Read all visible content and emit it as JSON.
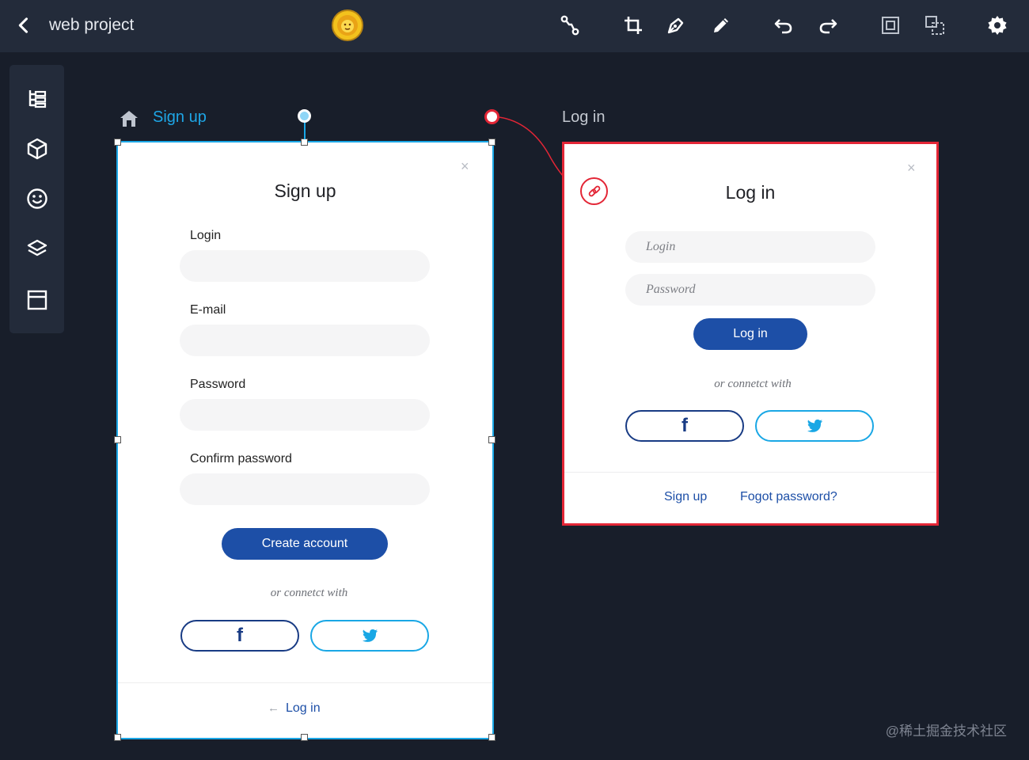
{
  "app": {
    "project_title": "web project",
    "watermark": "@稀土掘金技术社区"
  },
  "toolbar": {
    "back_icon": "chevron-left-icon",
    "tools": [
      "connect-icon",
      "crop-icon",
      "pen-icon",
      "pencil-icon",
      "undo-icon",
      "redo-icon",
      "frame-icon",
      "group-icon",
      "settings-icon"
    ]
  },
  "sidebar": {
    "items": [
      "layers-tree-icon",
      "cube-icon",
      "smiley-icon",
      "stack-icon",
      "panel-icon"
    ]
  },
  "colors": {
    "selection": "#1aa7e6",
    "link_accent": "#e32636",
    "primary": "#1d4fa7",
    "facebook": "#183b84",
    "twitter": "#19a7e5"
  },
  "signup_frame": {
    "label": "Sign up",
    "title": "Sign up",
    "close": "×",
    "fields": [
      {
        "label": "Login"
      },
      {
        "label": "E-mail"
      },
      {
        "label": "Password"
      },
      {
        "label": "Confirm password"
      }
    ],
    "button": "Create account",
    "connect_text": "or connetct with",
    "facebook": "f",
    "footer_arrow": "←",
    "footer_link": "Log in"
  },
  "login_frame": {
    "label": "Log in",
    "title": "Log in",
    "close": "×",
    "login_placeholder": "Login",
    "password_placeholder": "Password",
    "button": "Log in",
    "connect_text": "or connetct with",
    "facebook": "f",
    "signup_link": "Sign up",
    "forgot_link": "Fogot password?"
  }
}
